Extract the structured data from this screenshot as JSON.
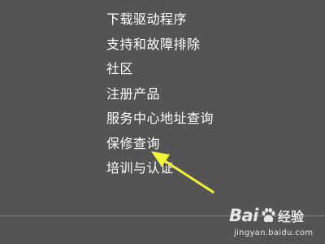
{
  "menu": {
    "items": [
      {
        "label": "下载驱动程序"
      },
      {
        "label": "支持和故障排除"
      },
      {
        "label": "社区"
      },
      {
        "label": "注册产品"
      },
      {
        "label": "服务中心地址查询"
      },
      {
        "label": "保修查询"
      },
      {
        "label": "培训与认证"
      }
    ]
  },
  "annotation": {
    "arrow_color": "#f4f43a",
    "points_to": "保修查询"
  },
  "watermark": {
    "brand_text": "Bai",
    "brand_suffix": "经验",
    "url": "jingyan.baidu.com",
    "icon": "paw-icon"
  },
  "colors": {
    "background": "#545454",
    "text": "#ffffff",
    "divider": "#888888"
  }
}
